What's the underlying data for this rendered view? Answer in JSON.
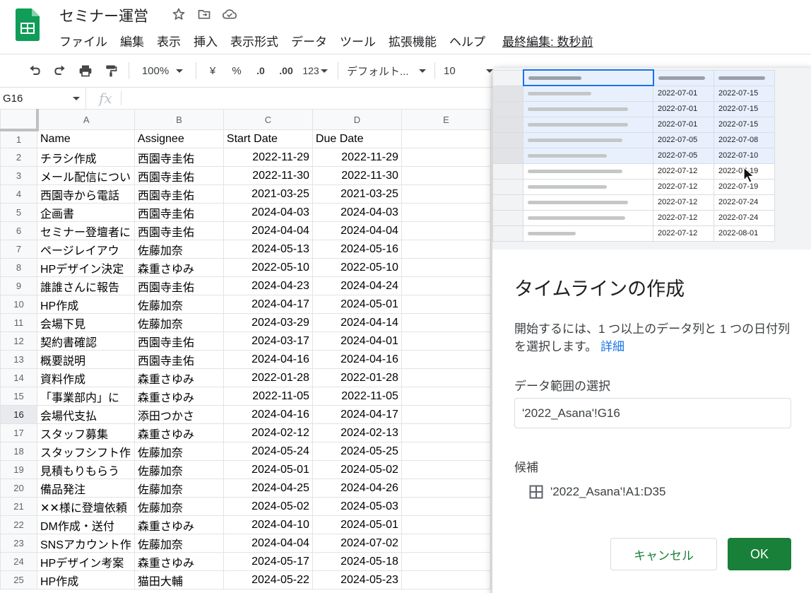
{
  "header": {
    "doc_title": "セミナー運営",
    "menu": [
      "ファイル",
      "編集",
      "表示",
      "挿入",
      "表示形式",
      "データ",
      "ツール",
      "拡張機能",
      "ヘルプ"
    ],
    "last_edit": "最終編集: 数秒前"
  },
  "toolbar": {
    "zoom": "100%",
    "currency": "¥",
    "percent": "%",
    "decimal_decrease": ".0",
    "decimal_increase": ".00",
    "more_formats": "123",
    "font": "デフォルト...",
    "font_size": "10"
  },
  "formula_bar": {
    "name_box": "G16",
    "fx": "fx"
  },
  "grid": {
    "columns": [
      "A",
      "B",
      "C",
      "D",
      "E"
    ],
    "rows": [
      [
        "1",
        "Name",
        "Assignee",
        "Start Date",
        "Due Date"
      ],
      [
        "2",
        "チラシ作成",
        "西園寺圭佑",
        "2022-11-29",
        "2022-11-29"
      ],
      [
        "3",
        "メール配信につい",
        "西園寺圭佑",
        "2022-11-30",
        "2022-11-30"
      ],
      [
        "4",
        "西園寺から電話",
        "西園寺圭佑",
        "2021-03-25",
        "2021-03-25"
      ],
      [
        "5",
        "企画書",
        "西園寺圭佑",
        "2024-04-03",
        "2024-04-03"
      ],
      [
        "6",
        "セミナー登壇者に",
        "西園寺圭佑",
        "2024-04-04",
        "2024-04-04"
      ],
      [
        "7",
        "ページレイアウ",
        "佐藤加奈",
        "2024-05-13",
        "2024-05-16"
      ],
      [
        "8",
        "HPデザイン決定",
        "森重さゆみ",
        "2022-05-10",
        "2022-05-10"
      ],
      [
        "9",
        "誰誰さんに報告",
        "西園寺圭佑",
        "2024-04-23",
        "2024-04-24"
      ],
      [
        "10",
        "HP作成",
        "佐藤加奈",
        "2024-04-17",
        "2024-05-01"
      ],
      [
        "11",
        "会場下見",
        "佐藤加奈",
        "2024-03-29",
        "2024-04-14"
      ],
      [
        "12",
        "契約書確認",
        "西園寺圭佑",
        "2024-03-17",
        "2024-04-01"
      ],
      [
        "13",
        "概要説明",
        "西園寺圭佑",
        "2024-04-16",
        "2024-04-16"
      ],
      [
        "14",
        "資料作成",
        "森重さゆみ",
        "2022-01-28",
        "2022-01-28"
      ],
      [
        "15",
        "「事業部内」に",
        "森重さゆみ",
        "2022-11-05",
        "2022-11-05"
      ],
      [
        "16",
        "会場代支払",
        "添田つかさ",
        "2024-04-16",
        "2024-04-17"
      ],
      [
        "17",
        "スタッフ募集",
        "森重さゆみ",
        "2024-02-12",
        "2024-02-13"
      ],
      [
        "18",
        "スタッフシフト作",
        "佐藤加奈",
        "2024-05-24",
        "2024-05-25"
      ],
      [
        "19",
        "見積もりもらう",
        "佐藤加奈",
        "2024-05-01",
        "2024-05-02"
      ],
      [
        "20",
        "備品発注",
        "佐藤加奈",
        "2024-04-25",
        "2024-04-26"
      ],
      [
        "21",
        "✕✕様に登壇依頼",
        "佐藤加奈",
        "2024-05-02",
        "2024-05-03"
      ],
      [
        "22",
        "DM作成・送付",
        "森重さゆみ",
        "2024-04-10",
        "2024-05-01"
      ],
      [
        "23",
        "SNSアカウント作",
        "佐藤加奈",
        "2024-04-04",
        "2024-07-02"
      ],
      [
        "24",
        "HPデザイン考案",
        "森重さゆみ",
        "2024-05-17",
        "2024-05-18"
      ],
      [
        "25",
        "HP作成",
        "猫田大輔",
        "2024-05-22",
        "2024-05-23"
      ]
    ]
  },
  "preview": {
    "rows": [
      [
        "",
        ""
      ],
      [
        "2022-07-01",
        "2022-07-15"
      ],
      [
        "2022-07-01",
        "2022-07-15"
      ],
      [
        "2022-07-01",
        "2022-07-15"
      ],
      [
        "2022-07-05",
        "2022-07-08"
      ],
      [
        "2022-07-05",
        "2022-07-10"
      ],
      [
        "2022-07-12",
        "2022-07-19"
      ],
      [
        "2022-07-12",
        "2022-07-19"
      ],
      [
        "2022-07-12",
        "2022-07-24"
      ],
      [
        "2022-07-12",
        "2022-07-24"
      ],
      [
        "2022-07-12",
        "2022-08-01"
      ]
    ]
  },
  "panel": {
    "title": "タイムラインの作成",
    "description": "開始するには、1 つ以上のデータ列と 1 つの日付列を選択します。",
    "learn_more": "詳細",
    "range_label": "データ範囲の選択",
    "range_value": "'2022_Asana'!G16",
    "suggestions_label": "候補",
    "suggestion_value": "'2022_Asana'!A1:D35",
    "cancel_label": "キャンセル",
    "ok_label": "OK"
  },
  "colors": {
    "accent_green": "#188038",
    "link_blue": "#1a73e8"
  }
}
